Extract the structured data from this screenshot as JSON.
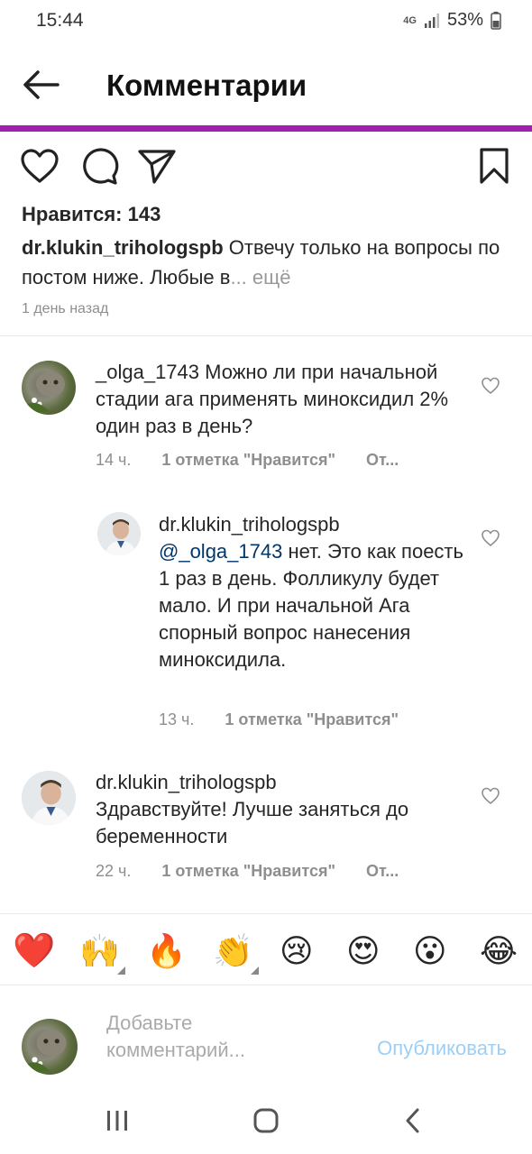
{
  "status": {
    "time": "15:44",
    "network": "4G",
    "battery": "53%"
  },
  "header": {
    "title": "Комментарии"
  },
  "post": {
    "likes": "Нравится: 143",
    "caption_user": "dr.klukin_triholog​spb",
    "caption_text": " Отвечу только на вопросы по постом ниже. Любые в",
    "caption_more": "... ещё",
    "time": "1 день назад"
  },
  "comments": [
    {
      "user": "_olga_1743",
      "text": " Можно ли при начальной стадии ага применять миноксидил 2% один раз в день?",
      "time": "14 ч.",
      "likes": "1 отметка \"Нравится\"",
      "reply": "От..."
    },
    {
      "user": "dr.klukin_trihologspb",
      "mention": "@_olga_1743",
      "text": " нет. Это как поесть 1 раз в день. Фолликулу будет мало. И при начальной Ага спорный вопрос нанесения миноксидила.",
      "time": "13 ч.",
      "likes": "1 отметка \"Нравится\""
    },
    {
      "user": "dr.klukin_trihologspb",
      "text": "Здравствуйте! Лучше заняться до беременности",
      "time": "22 ч.",
      "likes": "1 отметка \"Нравится\"",
      "reply": "От..."
    }
  ],
  "emoji_bar": [
    "❤️",
    "🙌",
    "🔥",
    "👏",
    "😢",
    "😍",
    "😮",
    "😂"
  ],
  "input": {
    "placeholder": "Добавьте комментарий...",
    "publish": "Опубликовать"
  },
  "icons": [
    "arrow-left-icon",
    "heart-icon",
    "comment-icon",
    "send-icon",
    "bookmark-icon"
  ],
  "colors": {
    "accent_line": "#a020b0",
    "publish": "#9ccff7",
    "mention": "#00376b"
  }
}
